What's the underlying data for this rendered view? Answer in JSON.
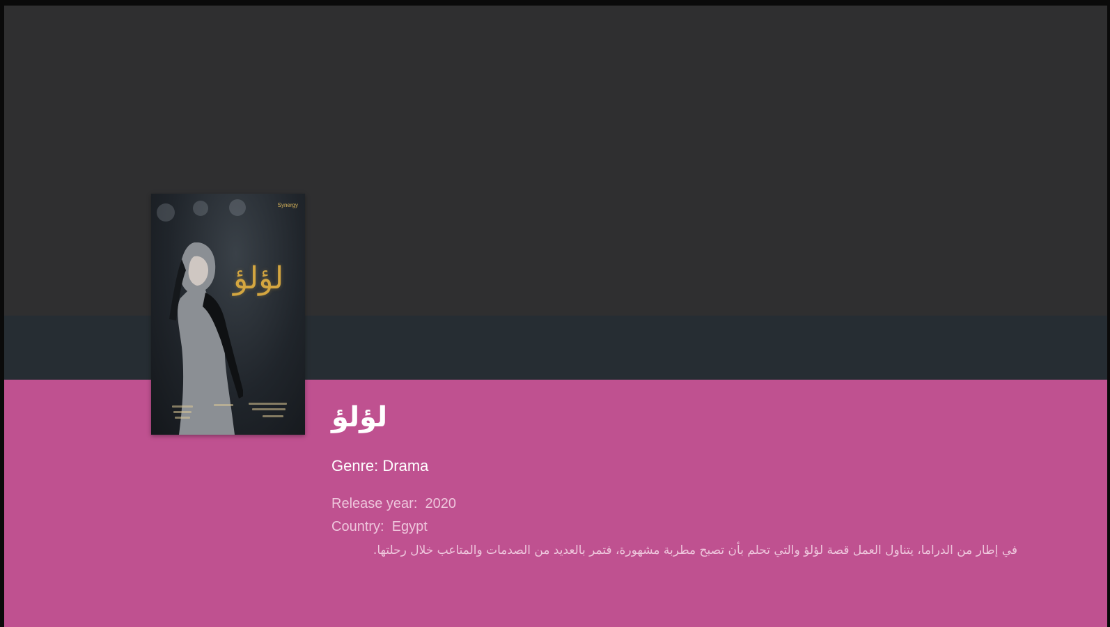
{
  "show": {
    "title": "لؤلؤ",
    "genre": "Genre: Drama",
    "release_label": "Release year:",
    "release_value": "2020",
    "country_label": "Country:",
    "country_value": "Egypt",
    "description": "في إطار من الدراما، يتناول العمل قصة لؤلؤ والتي تحلم بأن تصبح مطربة مشهورة، فتمر بالعديد من الصدمات والمتاعب خلال رحلتها."
  },
  "poster": {
    "title_art": "لؤلؤ",
    "brand": "Synergy"
  },
  "colors": {
    "background": "#2f2f30",
    "band": "#262d33",
    "panel": "#bf5190",
    "title_art_gold": "#d4a640"
  }
}
